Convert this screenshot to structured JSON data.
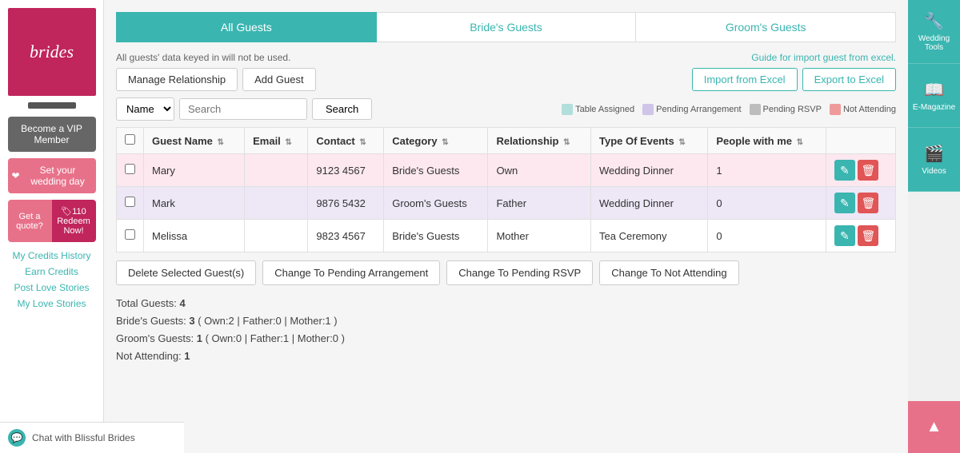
{
  "logo": {
    "text": "brides"
  },
  "sidebar": {
    "vip_label": "Become a VIP Member",
    "wedding_label": "Set your wedding day",
    "quote_label": "Get a quote?",
    "redeem_label": "🏷110 Redeem Now!",
    "links": [
      "My Credits History",
      "Earn Credits",
      "Post Love Stories",
      "My Love Stories"
    ]
  },
  "chat": {
    "label": "Chat with Blissful Brides"
  },
  "tabs": [
    {
      "label": "All Guests",
      "active": true
    },
    {
      "label": "Bride's Guests",
      "active": false
    },
    {
      "label": "Groom's Guests",
      "active": false
    }
  ],
  "info": {
    "warning_text": "All guests' data keyed in will not be used.",
    "guide_link": "Guide for import guest from excel."
  },
  "buttons": {
    "manage_relationship": "Manage Relationship",
    "add_guest": "Add Guest",
    "import": "Import from Excel",
    "export": "Export to Excel",
    "search": "Search",
    "search_placeholder": "Search",
    "search_field_default": "Name"
  },
  "legend": [
    {
      "label": "Table Assigned",
      "color": "#b2dfdb"
    },
    {
      "label": "Pending Arrangement",
      "color": "#d1c4e9"
    },
    {
      "label": "Pending RSVP",
      "color": "#bdbdbd"
    },
    {
      "label": "Not Attending",
      "color": "#ef9a9a"
    }
  ],
  "table": {
    "columns": [
      "Guest Name",
      "Email",
      "Contact",
      "Category",
      "Relationship",
      "Type Of Events",
      "People with me"
    ],
    "rows": [
      {
        "id": 1,
        "name": "Mary",
        "email": "",
        "contact": "9123 4567",
        "category": "Bride's Guests",
        "relationship": "Own",
        "type_of_events": "Wedding Dinner",
        "people": "1",
        "row_class": "row-pink"
      },
      {
        "id": 2,
        "name": "Mark",
        "email": "",
        "contact": "9876 5432",
        "category": "Groom's Guests",
        "relationship": "Father",
        "type_of_events": "Wedding Dinner",
        "people": "0",
        "row_class": "row-purple"
      },
      {
        "id": 3,
        "name": "Melissa",
        "email": "",
        "contact": "9823 4567",
        "category": "Bride's Guests",
        "relationship": "Mother",
        "type_of_events": "Tea Ceremony",
        "people": "0",
        "row_class": "row-white"
      }
    ]
  },
  "bottom_actions": [
    "Delete Selected Guest(s)",
    "Change To Pending Arrangement",
    "Change To Pending RSVP",
    "Change To Not Attending"
  ],
  "stats": {
    "total_label": "Total Guests:",
    "total_value": "4",
    "brides_label": "Bride's Guests:",
    "brides_value": "3",
    "brides_detail": "( Own:2 | Father:0 | Mother:1 )",
    "grooms_label": "Groom's Guests:",
    "grooms_value": "1",
    "grooms_detail": "( Own:0 | Father:1 | Mother:0 )",
    "not_attending_label": "Not Attending:",
    "not_attending_value": "1"
  },
  "right_panel": {
    "tools": [
      {
        "icon": "🔧",
        "label": "Wedding Tools"
      },
      {
        "icon": "📖",
        "label": "E-Magazine"
      },
      {
        "icon": "🎬",
        "label": "Videos"
      }
    ],
    "up_icon": "▲"
  }
}
